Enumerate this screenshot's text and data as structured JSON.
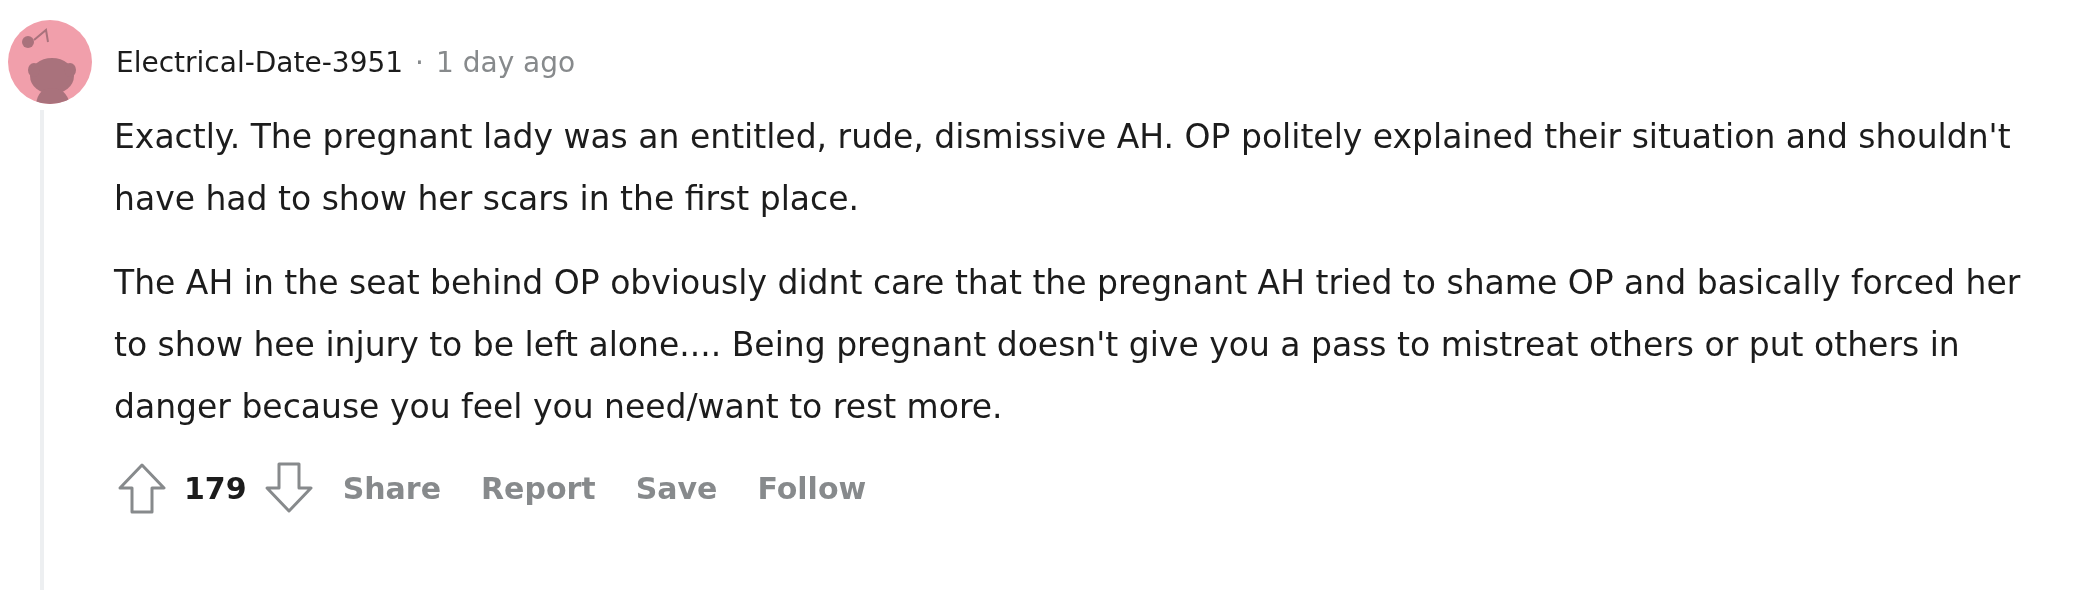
{
  "comment": {
    "author": "Electrical-Date-3951",
    "separator": "·",
    "time": "1 day ago",
    "paragraphs": [
      "Exactly. The pregnant lady was an entitled, rude, dismissive AH. OP politely explained their situation and shouldn't have had to show her scars in the first place.",
      "The AH in the seat behind OP obviously didnt care that the pregnant AH tried to shame OP and basically forced her to show hee injury to be left alone.... Being pregnant doesn't give you a pass to mistreat others or put others in danger because you feel you need/want to rest more."
    ],
    "score": "179",
    "actions": [
      "Share",
      "Report",
      "Save",
      "Follow"
    ]
  }
}
